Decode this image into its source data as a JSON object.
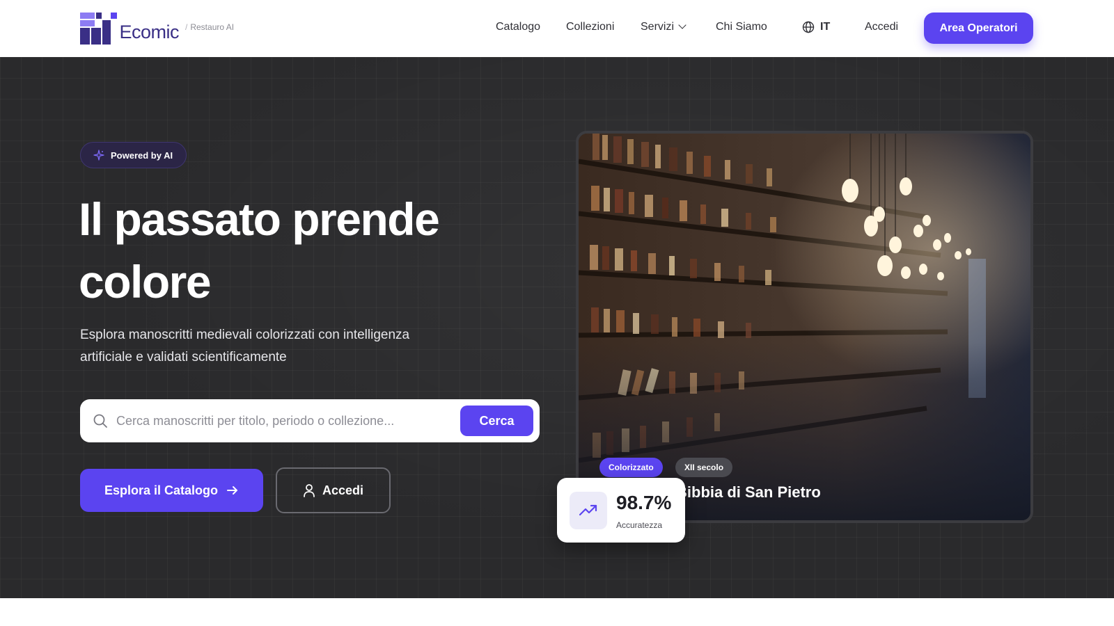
{
  "brand": {
    "name": "Ecomic",
    "tagline": "Restauro AI",
    "accent": "#5b44f0",
    "logo_dark": "#3a2f86"
  },
  "nav": {
    "items": [
      "Catalogo",
      "Collezioni",
      "Servizi",
      "Chi Siamo"
    ],
    "language": "IT",
    "login": "Accedi",
    "operators_button": "Area Operatori"
  },
  "hero": {
    "badge": "Powered by AI",
    "headline_line1": "Il passato prende",
    "headline_line2": "colore",
    "subtitle": "Esplora manoscritti medievali colorizzati con intelligenza artificiale e validati scientificamente",
    "search": {
      "placeholder": "Cerca manoscritti per titolo, periodo o collezione...",
      "button": "Cerca"
    },
    "cta_explore": "Esplora il Catalogo",
    "cta_login": "Accedi"
  },
  "card": {
    "tags": [
      "Colorizzato",
      "XII secolo"
    ],
    "title": "Bibbia di San Pietro"
  },
  "stat": {
    "value": "98.7%",
    "label": "Accuratezza"
  },
  "icons": {
    "badge": "sparkle-icon",
    "search": "search-icon",
    "arrow": "arrow-right-icon",
    "user": "user-icon",
    "globe": "globe-icon",
    "stat": "trending-up-icon"
  }
}
